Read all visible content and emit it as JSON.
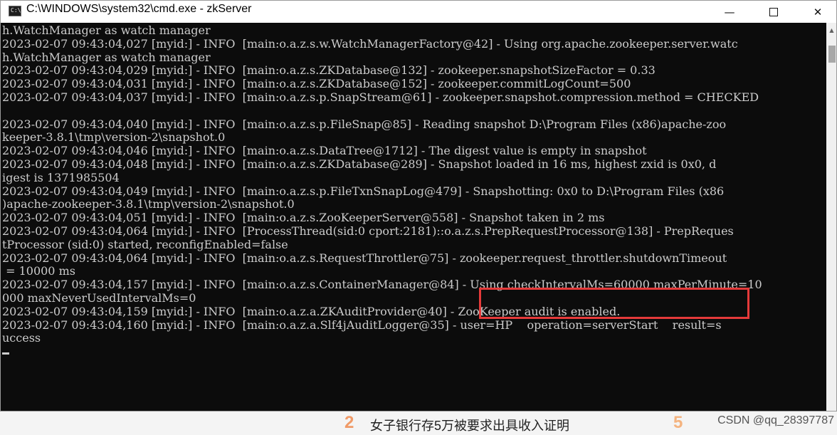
{
  "window": {
    "title": "C:\\WINDOWS\\system32\\cmd.exe - zkServer",
    "minimize_glyph": "—",
    "close_glyph": "✕"
  },
  "console_lines": [
    "h.WatchManager as watch manager",
    "2023-02-07 09:43:04,027 [myid:] - INFO  [main:o.a.z.s.w.WatchManagerFactory@42] - Using org.apache.zookeeper.server.watc",
    "h.WatchManager as watch manager",
    "2023-02-07 09:43:04,029 [myid:] - INFO  [main:o.a.z.s.ZKDatabase@132] - zookeeper.snapshotSizeFactor = 0.33",
    "2023-02-07 09:43:04,031 [myid:] - INFO  [main:o.a.z.s.ZKDatabase@152] - zookeeper.commitLogCount=500",
    "2023-02-07 09:43:04,037 [myid:] - INFO  [main:o.a.z.s.p.SnapStream@61] - zookeeper.snapshot.compression.method = CHECKED",
    "",
    "2023-02-07 09:43:04,040 [myid:] - INFO  [main:o.a.z.s.p.FileSnap@85] - Reading snapshot D:\\Program Files (x86)apache-zoo",
    "keeper-3.8.1\\tmp\\version-2\\snapshot.0",
    "2023-02-07 09:43:04,046 [myid:] - INFO  [main:o.a.z.s.DataTree@1712] - The digest value is empty in snapshot",
    "2023-02-07 09:43:04,048 [myid:] - INFO  [main:o.a.z.s.ZKDatabase@289] - Snapshot loaded in 16 ms, highest zxid is 0x0, d",
    "igest is 1371985504",
    "2023-02-07 09:43:04,049 [myid:] - INFO  [main:o.a.z.s.p.FileTxnSnapLog@479] - Snapshotting: 0x0 to D:\\Program Files (x86",
    ")apache-zookeeper-3.8.1\\tmp\\version-2\\snapshot.0",
    "2023-02-07 09:43:04,051 [myid:] - INFO  [main:o.a.z.s.ZooKeeperServer@558] - Snapshot taken in 2 ms",
    "2023-02-07 09:43:04,064 [myid:] - INFO  [ProcessThread(sid:0 cport:2181)::o.a.z.s.PrepRequestProcessor@138] - PrepReques",
    "tProcessor (sid:0) started, reconfigEnabled=false",
    "2023-02-07 09:43:04,064 [myid:] - INFO  [main:o.a.z.s.RequestThrottler@75] - zookeeper.request_throttler.shutdownTimeout",
    " = 10000 ms",
    "2023-02-07 09:43:04,157 [myid:] - INFO  [main:o.a.z.s.ContainerManager@84] - Using checkIntervalMs=60000 maxPerMinute=10",
    "000 maxNeverUsedIntervalMs=0",
    "2023-02-07 09:43:04,159 [myid:] - INFO  [main:o.a.z.a.ZKAuditProvider@40] - ZooKeeper audit is enabled.",
    "2023-02-07 09:43:04,160 [myid:] - INFO  [main:o.a.z.a.Slf4jAuditLogger@35] - user=HP    operation=serverStart    result=s",
    "uccess"
  ],
  "underlying_page": {
    "item_number_1": "2",
    "item_text": "女子银行存5万被要求出具收入证明",
    "item_number_2": "5",
    "watermark": "CSDN @qq_28397787"
  },
  "colors": {
    "console_bg": "#0c0c0c",
    "console_text": "#cccccc",
    "highlight_border": "#e53a3a"
  }
}
